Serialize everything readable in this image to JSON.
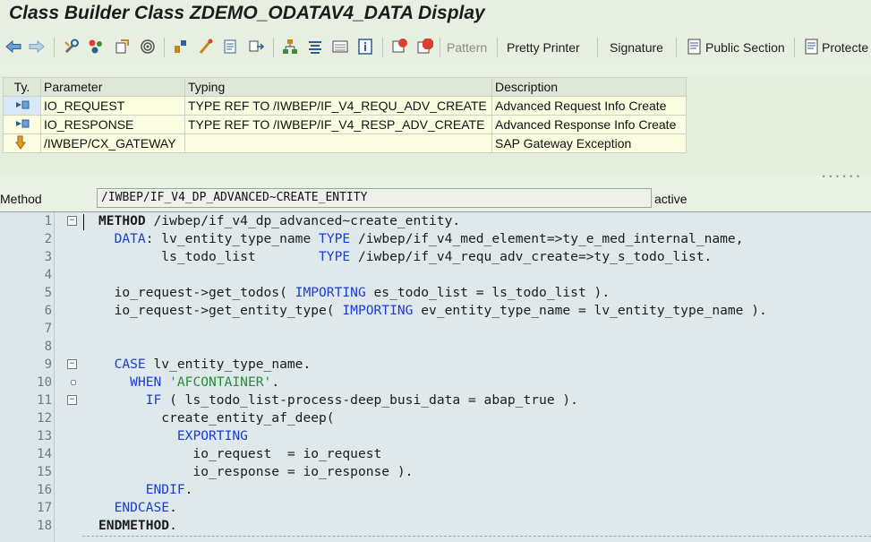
{
  "window": {
    "title": "Class Builder Class ZDEMO_ODATAV4_DATA Display"
  },
  "toolbar": {
    "icons": [
      "back-arrow-icon",
      "forward-arrow-icon",
      "tools-icon",
      "other-object-icon",
      "display-change-icon",
      "where-used-icon",
      "check-icon",
      "activate-icon",
      "test-icon",
      "window-icon",
      "hierarchy-icon",
      "stack-icon",
      "list-icon",
      "info-icon",
      "breakpoint-icon",
      "stop-icon"
    ],
    "pattern": "Pattern",
    "pretty_printer": "Pretty Printer",
    "signature": "Signature",
    "public_section": "Public Section",
    "protected_section": "Protecte"
  },
  "params": {
    "headers": {
      "type": "Ty.",
      "parameter": "Parameter",
      "typing": "Typing",
      "description": "Description"
    },
    "rows": [
      {
        "type_icon": "importing-icon",
        "name": "IO_REQUEST",
        "typing": "TYPE REF TO /IWBEP/IF_V4_REQU_ADV_CREATE",
        "description": "Advanced Request Info Create"
      },
      {
        "type_icon": "importing-icon",
        "name": "IO_RESPONSE",
        "typing": "TYPE REF TO /IWBEP/IF_V4_RESP_ADV_CREATE",
        "description": "Advanced Response Info Create"
      },
      {
        "type_icon": "exception-icon",
        "name": "/IWBEP/CX_GATEWAY",
        "typing": "",
        "description": "SAP Gateway Exception"
      }
    ]
  },
  "method": {
    "label": "Method",
    "value": "/IWBEP/IF_V4_DP_ADVANCED~CREATE_ENTITY",
    "status": "active"
  },
  "editor": {
    "lines": [
      {
        "n": "1",
        "fold": "minus",
        "tokens": [
          {
            "t": "METHOD",
            "c": "kwb"
          },
          {
            "t": " /iwbep/if_v4_dp_advanced~create_entity."
          }
        ]
      },
      {
        "n": "2",
        "fold": "",
        "tokens": [
          {
            "t": "  "
          },
          {
            "t": "DATA",
            "c": "kw"
          },
          {
            "t": ": lv_entity_type_name "
          },
          {
            "t": "TYPE",
            "c": "kw"
          },
          {
            "t": " /iwbep/if_v4_med_element=>ty_e_med_internal_name,"
          }
        ]
      },
      {
        "n": "3",
        "fold": "",
        "tokens": [
          {
            "t": "        ls_todo_list        "
          },
          {
            "t": "TYPE",
            "c": "kw"
          },
          {
            "t": " /iwbep/if_v4_requ_adv_create=>ty_s_todo_list."
          }
        ]
      },
      {
        "n": "4",
        "fold": "",
        "tokens": []
      },
      {
        "n": "5",
        "fold": "",
        "tokens": [
          {
            "t": "  io_request->get_todos( "
          },
          {
            "t": "IMPORTING",
            "c": "kw"
          },
          {
            "t": " es_todo_list = ls_todo_list )."
          }
        ]
      },
      {
        "n": "6",
        "fold": "",
        "tokens": [
          {
            "t": "  io_request->get_entity_type( "
          },
          {
            "t": "IMPORTING",
            "c": "kw"
          },
          {
            "t": " ev_entity_type_name = lv_entity_type_name )."
          }
        ]
      },
      {
        "n": "7",
        "fold": "",
        "tokens": []
      },
      {
        "n": "8",
        "fold": "",
        "tokens": []
      },
      {
        "n": "9",
        "fold": "minus",
        "tokens": [
          {
            "t": "  "
          },
          {
            "t": "CASE",
            "c": "kw"
          },
          {
            "t": " lv_entity_type_name."
          }
        ]
      },
      {
        "n": "10",
        "fold": "dot",
        "tokens": [
          {
            "t": "    "
          },
          {
            "t": "WHEN",
            "c": "kw"
          },
          {
            "t": " "
          },
          {
            "t": "'AFCONTAINER'",
            "c": "str"
          },
          {
            "t": "."
          }
        ]
      },
      {
        "n": "11",
        "fold": "minus",
        "tokens": [
          {
            "t": "      "
          },
          {
            "t": "IF",
            "c": "kw"
          },
          {
            "t": " ( ls_todo_list-process-deep_busi_data = abap_true )."
          }
        ]
      },
      {
        "n": "12",
        "fold": "",
        "tokens": [
          {
            "t": "        create_entity_af_deep("
          }
        ]
      },
      {
        "n": "13",
        "fold": "",
        "tokens": [
          {
            "t": "          "
          },
          {
            "t": "EXPORTING",
            "c": "kw"
          }
        ]
      },
      {
        "n": "14",
        "fold": "",
        "tokens": [
          {
            "t": "            io_request  = io_request"
          }
        ]
      },
      {
        "n": "15",
        "fold": "",
        "tokens": [
          {
            "t": "            io_response = io_response )."
          }
        ]
      },
      {
        "n": "16",
        "fold": "",
        "tokens": [
          {
            "t": "      "
          },
          {
            "t": "ENDIF",
            "c": "kw"
          },
          {
            "t": "."
          }
        ]
      },
      {
        "n": "17",
        "fold": "",
        "tokens": [
          {
            "t": "  "
          },
          {
            "t": "ENDCASE",
            "c": "kw"
          },
          {
            "t": "."
          }
        ]
      },
      {
        "n": "18",
        "fold": "",
        "tokens": [
          {
            "t": "ENDMETHOD",
            "c": "kwb"
          },
          {
            "t": "."
          }
        ]
      }
    ]
  }
}
